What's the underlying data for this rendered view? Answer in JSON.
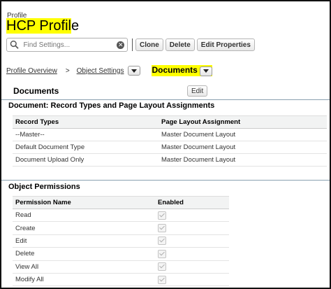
{
  "header": {
    "profile_label": "Profile",
    "title": "HCP Profile",
    "title_highlighted": "HCP Profil",
    "title_rest": "e"
  },
  "toolbar": {
    "search_placeholder": "Find Settings...",
    "clone_label": "Clone",
    "delete_label": "Delete",
    "edit_properties_label": "Edit Properties"
  },
  "breadcrumb": {
    "profile_overview": "Profile Overview",
    "separator": ">",
    "object_settings": "Object Settings",
    "current": "Documents"
  },
  "section": {
    "title": "Documents",
    "edit_label": "Edit"
  },
  "record_types": {
    "heading": "Document: Record Types and Page Layout Assignments",
    "columns": [
      "Record Types",
      "Page Layout Assignment"
    ],
    "rows": [
      [
        "--Master--",
        "Master Document Layout"
      ],
      [
        "Default Document Type",
        "Master Document Layout"
      ],
      [
        "Document Upload Only",
        "Master Document Layout"
      ]
    ]
  },
  "object_permissions": {
    "heading": "Object Permissions",
    "columns": [
      "Permission Name",
      "Enabled"
    ],
    "rows": [
      {
        "name": "Read",
        "enabled": true
      },
      {
        "name": "Create",
        "enabled": true
      },
      {
        "name": "Edit",
        "enabled": true
      },
      {
        "name": "Delete",
        "enabled": true
      },
      {
        "name": "View All",
        "enabled": true
      },
      {
        "name": "Modify All",
        "enabled": true
      }
    ]
  },
  "colors": {
    "highlight": "#ffff00",
    "section_border": "#8aa0b0",
    "table_header_bg": "#f2f3f3"
  }
}
